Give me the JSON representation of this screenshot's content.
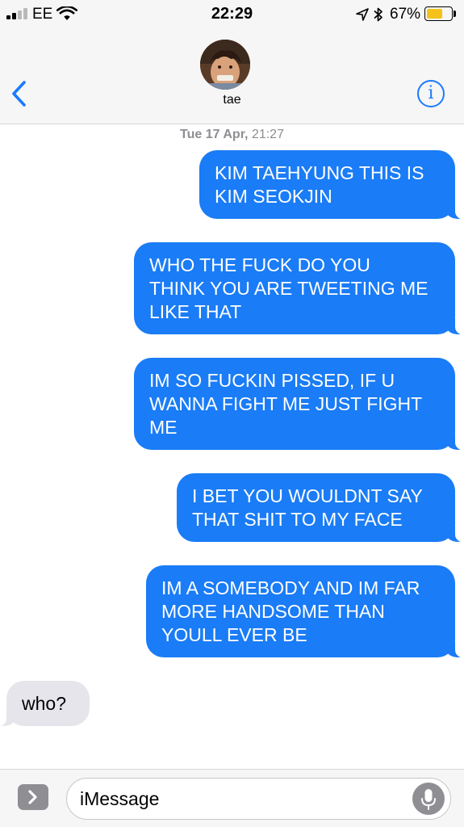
{
  "status_bar": {
    "carrier": "EE",
    "time": "22:29",
    "battery_percent": "67%",
    "battery_level": 0.67,
    "signal_bars_filled": 2,
    "signal_bars_total": 4,
    "battery_color": "#f5c21b",
    "icons": [
      "signal-icon",
      "wifi-icon",
      "location-icon",
      "bluetooth-icon",
      "battery-icon"
    ]
  },
  "header": {
    "back_icon": "chevron-left-icon",
    "contact_name": "tae",
    "info_icon": "info-icon",
    "info_label": "i",
    "accent_color": "#1a7bff"
  },
  "conversation": {
    "timestamp_day": "Tue 17 Apr,",
    "timestamp_time": "21:27",
    "messages": [
      {
        "direction": "sent",
        "text": "KIM TAEHYUNG THIS IS\nKIM SEOKJIN"
      },
      {
        "direction": "sent",
        "text": "WHO THE FUCK DO YOU\nTHINK YOU ARE TWEETING ME\nLIKE THAT"
      },
      {
        "direction": "sent",
        "text": "IM SO FUCKIN PISSED, IF U\nWANNA FIGHT ME JUST FIGHT\nME"
      },
      {
        "direction": "sent",
        "text": "I BET YOU WOULDNT SAY\nTHAT SHIT TO MY FACE"
      },
      {
        "direction": "sent",
        "text": "IM A SOMEBODY AND IM FAR\nMORE HANDSOME THAN\nYOULL EVER BE"
      },
      {
        "direction": "received",
        "text": "who?"
      }
    ],
    "sent_bubble_color": "#1a7cf6",
    "received_bubble_color": "#e6e5eb"
  },
  "input_bar": {
    "apps_icon": "apps-chevron-icon",
    "placeholder": "iMessage",
    "mic_icon": "microphone-icon"
  }
}
